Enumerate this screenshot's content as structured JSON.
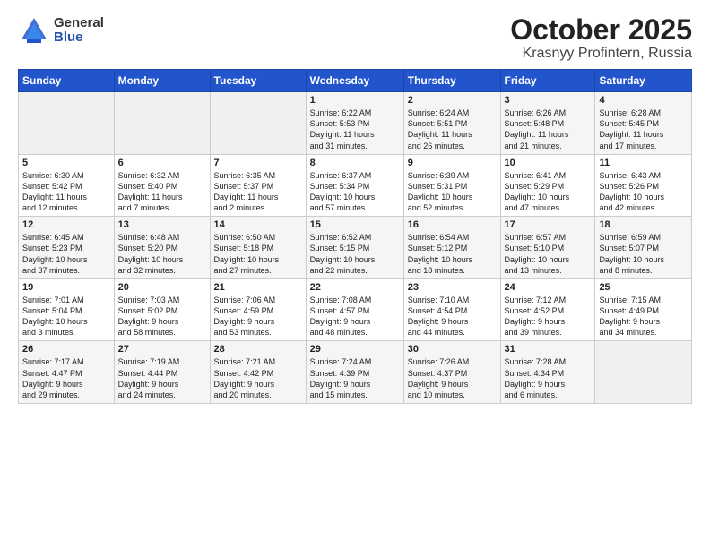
{
  "header": {
    "logo_general": "General",
    "logo_blue": "Blue",
    "title": "October 2025",
    "location": "Krasnyy Profintern, Russia"
  },
  "days_of_week": [
    "Sunday",
    "Monday",
    "Tuesday",
    "Wednesday",
    "Thursday",
    "Friday",
    "Saturday"
  ],
  "weeks": [
    [
      {
        "day": "",
        "info": ""
      },
      {
        "day": "",
        "info": ""
      },
      {
        "day": "",
        "info": ""
      },
      {
        "day": "1",
        "info": "Sunrise: 6:22 AM\nSunset: 5:53 PM\nDaylight: 11 hours\nand 31 minutes."
      },
      {
        "day": "2",
        "info": "Sunrise: 6:24 AM\nSunset: 5:51 PM\nDaylight: 11 hours\nand 26 minutes."
      },
      {
        "day": "3",
        "info": "Sunrise: 6:26 AM\nSunset: 5:48 PM\nDaylight: 11 hours\nand 21 minutes."
      },
      {
        "day": "4",
        "info": "Sunrise: 6:28 AM\nSunset: 5:45 PM\nDaylight: 11 hours\nand 17 minutes."
      }
    ],
    [
      {
        "day": "5",
        "info": "Sunrise: 6:30 AM\nSunset: 5:42 PM\nDaylight: 11 hours\nand 12 minutes."
      },
      {
        "day": "6",
        "info": "Sunrise: 6:32 AM\nSunset: 5:40 PM\nDaylight: 11 hours\nand 7 minutes."
      },
      {
        "day": "7",
        "info": "Sunrise: 6:35 AM\nSunset: 5:37 PM\nDaylight: 11 hours\nand 2 minutes."
      },
      {
        "day": "8",
        "info": "Sunrise: 6:37 AM\nSunset: 5:34 PM\nDaylight: 10 hours\nand 57 minutes."
      },
      {
        "day": "9",
        "info": "Sunrise: 6:39 AM\nSunset: 5:31 PM\nDaylight: 10 hours\nand 52 minutes."
      },
      {
        "day": "10",
        "info": "Sunrise: 6:41 AM\nSunset: 5:29 PM\nDaylight: 10 hours\nand 47 minutes."
      },
      {
        "day": "11",
        "info": "Sunrise: 6:43 AM\nSunset: 5:26 PM\nDaylight: 10 hours\nand 42 minutes."
      }
    ],
    [
      {
        "day": "12",
        "info": "Sunrise: 6:45 AM\nSunset: 5:23 PM\nDaylight: 10 hours\nand 37 minutes."
      },
      {
        "day": "13",
        "info": "Sunrise: 6:48 AM\nSunset: 5:20 PM\nDaylight: 10 hours\nand 32 minutes."
      },
      {
        "day": "14",
        "info": "Sunrise: 6:50 AM\nSunset: 5:18 PM\nDaylight: 10 hours\nand 27 minutes."
      },
      {
        "day": "15",
        "info": "Sunrise: 6:52 AM\nSunset: 5:15 PM\nDaylight: 10 hours\nand 22 minutes."
      },
      {
        "day": "16",
        "info": "Sunrise: 6:54 AM\nSunset: 5:12 PM\nDaylight: 10 hours\nand 18 minutes."
      },
      {
        "day": "17",
        "info": "Sunrise: 6:57 AM\nSunset: 5:10 PM\nDaylight: 10 hours\nand 13 minutes."
      },
      {
        "day": "18",
        "info": "Sunrise: 6:59 AM\nSunset: 5:07 PM\nDaylight: 10 hours\nand 8 minutes."
      }
    ],
    [
      {
        "day": "19",
        "info": "Sunrise: 7:01 AM\nSunset: 5:04 PM\nDaylight: 10 hours\nand 3 minutes."
      },
      {
        "day": "20",
        "info": "Sunrise: 7:03 AM\nSunset: 5:02 PM\nDaylight: 9 hours\nand 58 minutes."
      },
      {
        "day": "21",
        "info": "Sunrise: 7:06 AM\nSunset: 4:59 PM\nDaylight: 9 hours\nand 53 minutes."
      },
      {
        "day": "22",
        "info": "Sunrise: 7:08 AM\nSunset: 4:57 PM\nDaylight: 9 hours\nand 48 minutes."
      },
      {
        "day": "23",
        "info": "Sunrise: 7:10 AM\nSunset: 4:54 PM\nDaylight: 9 hours\nand 44 minutes."
      },
      {
        "day": "24",
        "info": "Sunrise: 7:12 AM\nSunset: 4:52 PM\nDaylight: 9 hours\nand 39 minutes."
      },
      {
        "day": "25",
        "info": "Sunrise: 7:15 AM\nSunset: 4:49 PM\nDaylight: 9 hours\nand 34 minutes."
      }
    ],
    [
      {
        "day": "26",
        "info": "Sunrise: 7:17 AM\nSunset: 4:47 PM\nDaylight: 9 hours\nand 29 minutes."
      },
      {
        "day": "27",
        "info": "Sunrise: 7:19 AM\nSunset: 4:44 PM\nDaylight: 9 hours\nand 24 minutes."
      },
      {
        "day": "28",
        "info": "Sunrise: 7:21 AM\nSunset: 4:42 PM\nDaylight: 9 hours\nand 20 minutes."
      },
      {
        "day": "29",
        "info": "Sunrise: 7:24 AM\nSunset: 4:39 PM\nDaylight: 9 hours\nand 15 minutes."
      },
      {
        "day": "30",
        "info": "Sunrise: 7:26 AM\nSunset: 4:37 PM\nDaylight: 9 hours\nand 10 minutes."
      },
      {
        "day": "31",
        "info": "Sunrise: 7:28 AM\nSunset: 4:34 PM\nDaylight: 9 hours\nand 6 minutes."
      },
      {
        "day": "",
        "info": ""
      }
    ]
  ]
}
